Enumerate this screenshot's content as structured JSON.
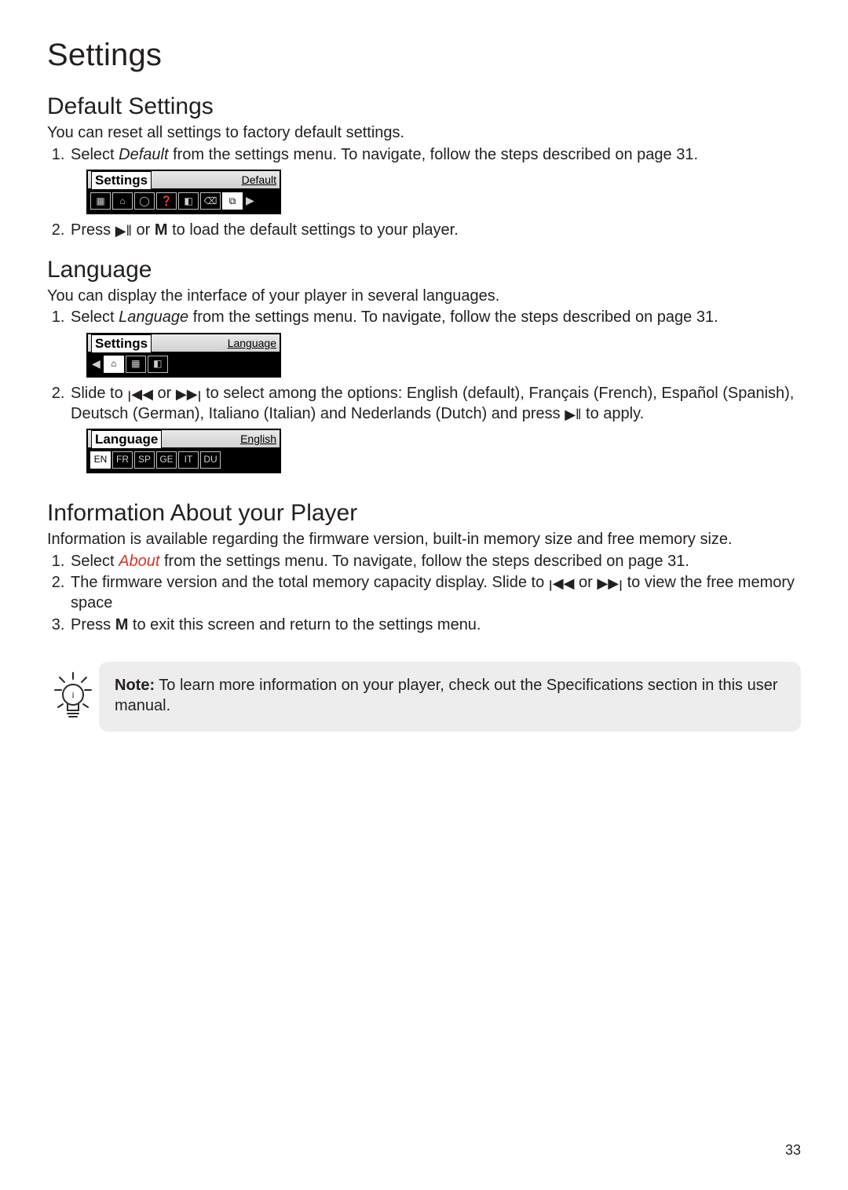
{
  "page": {
    "title": "Settings",
    "number": "33"
  },
  "sec_default": {
    "heading": "Default Settings",
    "intro": "You can reset all settings to factory default settings.",
    "step1_a": "Select ",
    "step1_b": "Default",
    "step1_c": " from the settings menu. To navigate, follow the steps described on page 31.",
    "step2_a": "Press ",
    "step2_b": " or ",
    "step2_c": "M",
    "step2_d": " to load the default settings to your player.",
    "lcd": {
      "tab": "Settings",
      "selected": "Default",
      "icons": [
        "▦",
        "⌂",
        "◯",
        "❓",
        "◧",
        "⌫",
        "⧉"
      ],
      "arrow": "▶"
    }
  },
  "sec_language": {
    "heading": "Language",
    "intro": "You can display the interface of your player in several languages.",
    "step1_a": "Select ",
    "step1_b": "Language",
    "step1_c": " from the settings menu. To navigate, follow the steps described on page 31.",
    "step2_a": "Slide to ",
    "step2_b": " or ",
    "step2_c": " to select among the options: English (default), Français (French), Español (Spanish), Deutsch (German), Italiano (Italian) and Nederlands (Dutch) and press ",
    "step2_d": " to apply.",
    "lcd1": {
      "tab": "Settings",
      "selected": "Language",
      "icons": [
        "⌂",
        "▦",
        "◧"
      ],
      "arrow_left": "◀"
    },
    "lcd2": {
      "tab": "Language",
      "selected": "English",
      "icons": [
        "EN",
        "FR",
        "SP",
        "GE",
        "IT",
        "DU"
      ]
    }
  },
  "sec_info": {
    "heading": "Information About your Player",
    "intro": "Information is available regarding the firmware version, built-in memory size and free memory size.",
    "step1_a": "Select ",
    "step1_b": "About",
    "step1_c": " from the settings menu. To navigate, follow the steps described on page 31.",
    "step2_a": "The firmware version and the total memory capacity display. Slide to ",
    "step2_b": " or ",
    "step2_c": " to view the free memory space",
    "step3_a": "Press ",
    "step3_b": "M",
    "step3_c": " to exit this screen and return to the settings menu."
  },
  "note": {
    "label": "Note:",
    "text": " To learn more information on your player, check out the Specifications section in this user manual."
  },
  "glyphs": {
    "play_pause": "▶ǁ",
    "prev": "ꞁ◀◀",
    "next": "▶▶ꞁ"
  }
}
